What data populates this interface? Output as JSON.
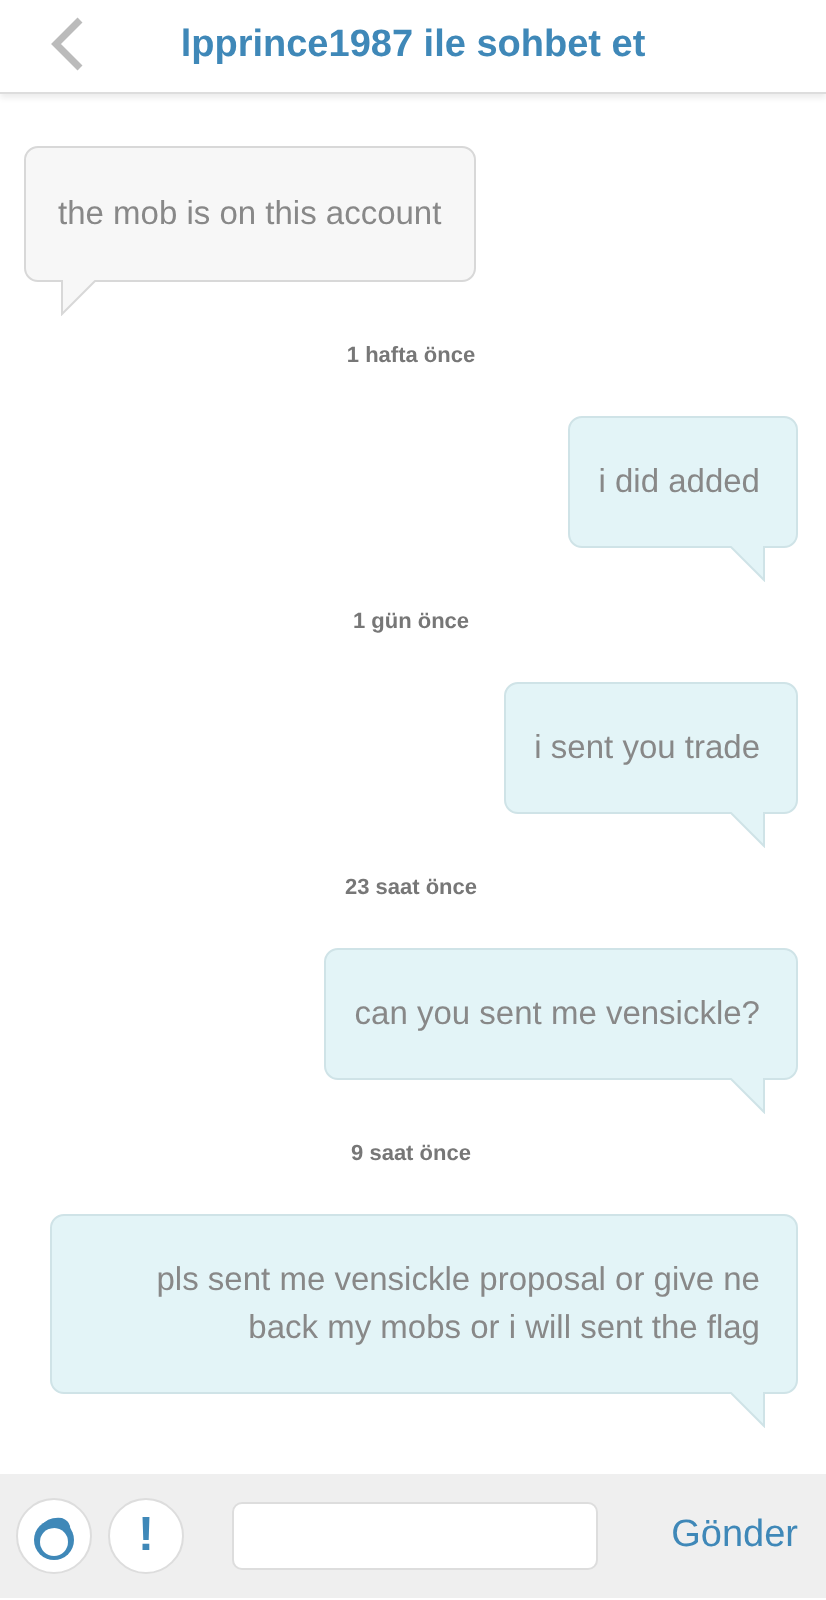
{
  "header": {
    "title": "lpprince1987 ile sohbet et"
  },
  "messages": [
    {
      "kind": "received",
      "text": "the mob is on this account"
    },
    {
      "kind": "time",
      "text": "1 hafta önce"
    },
    {
      "kind": "sent",
      "text": "i did added"
    },
    {
      "kind": "time",
      "text": "1 gün önce"
    },
    {
      "kind": "sent",
      "text": "i sent you trade"
    },
    {
      "kind": "time",
      "text": "23 saat önce"
    },
    {
      "kind": "sent",
      "text": "can you sent me vensickle?"
    },
    {
      "kind": "time",
      "text": "9 saat önce"
    },
    {
      "kind": "sent",
      "text": "pls sent me vensickle proposal or give ne back my mobs or i will sent the flag"
    }
  ],
  "composer": {
    "report_button": "!",
    "send_button": "Gönder"
  }
}
